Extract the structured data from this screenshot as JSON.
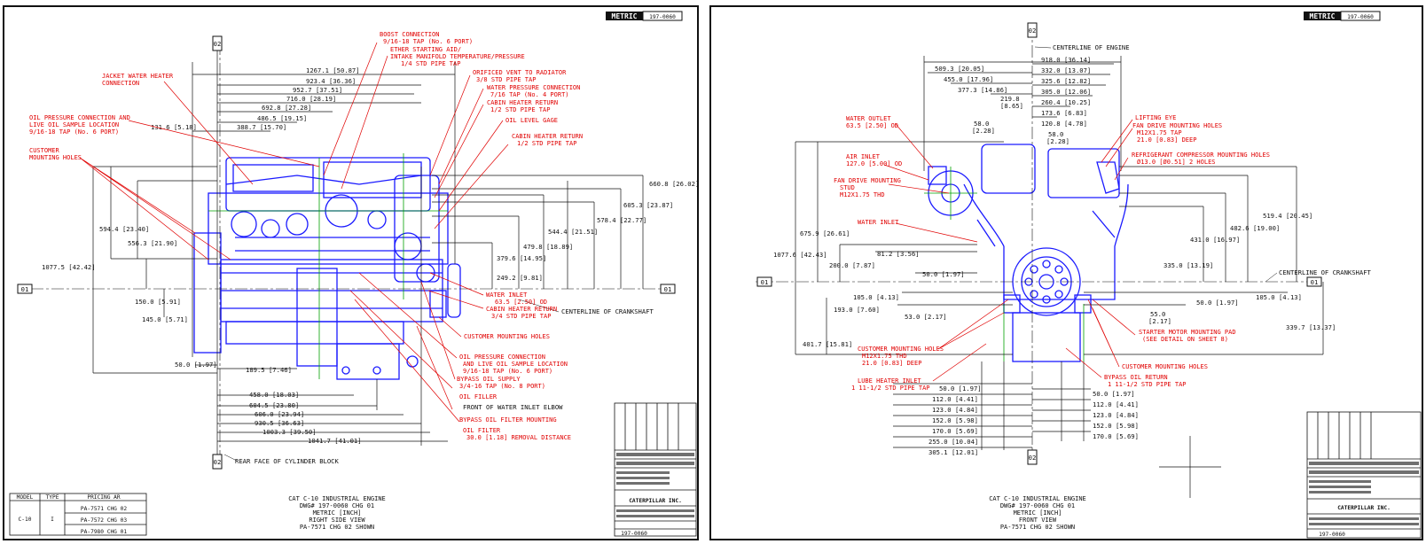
{
  "colors": {
    "engine": "#1a1aff",
    "callout": "#e00000",
    "dimension": "#111111",
    "centerline": "#00a000"
  },
  "sheet_left": {
    "metric_badge": "METRIC",
    "drawing_no": "197-0060",
    "callouts": {
      "boost": "BOOST CONNECTION",
      "boost_tap": "9/16-18 TAP (No. 6 PORT)",
      "ether": "ETHER STARTING AID/",
      "ether2": "INTAKE MANIFOLD TEMPERATURE/PRESSURE",
      "ether3": "1/4 STD PIPE TAP",
      "jacket": "JACKET WATER HEATER",
      "jacket2": "CONNECTION",
      "oil_pressure": "OIL PRESSURE CONNECTION AND",
      "oil_pressure2": "LIVE OIL SAMPLE LOCATION",
      "oil_pressure3": "9/16-18 TAP (No. 6 PORT)",
      "customer_mount": "CUSTOMER",
      "customer_mount2": "MOUNTING HOLES",
      "orificed": "ORIFICED VENT TO RADIATOR",
      "orificed2": "3/8 STD PIPE TAP",
      "water_pressure": "WATER PRESSURE CONNECTION",
      "water_pressure2": "7/16 TAP (No. 4 PORT)",
      "cabin_return": "CABIN HEATER RETURN",
      "cabin_return2": "1/2 STD PIPE TAP",
      "oil_level": "OIL LEVEL GAGE",
      "cabin_return_b": "CABIN HEATER RETURN",
      "cabin_return_b2": "1/2 STD PIPE TAP",
      "water_inlet": "WATER INLET",
      "water_inlet2": "63.5 [2.50] OD",
      "cabin_heater": "CABIN HEATER RETURN",
      "cabin_heater2": "3/4 STD PIPE TAP",
      "cust_holes": "CUSTOMER MOUNTING HOLES",
      "oil_pressure_b": "OIL PRESSURE CONNECTION",
      "oil_pressure_b2": "AND LIVE OIL SAMPLE LOCATION",
      "oil_pressure_b3": "9/16-18 TAP (No. 6 PORT)",
      "bypass_supply": "BYPASS OIL SUPPLY",
      "bypass_supply2": "3/4-16 TAP (No. 8 PORT)",
      "oil_filler": "OIL FILLER",
      "front_water": "FRONT OF WATER INLET ELBOW",
      "bypass_filter": "BYPASS OIL FILTER MOUNTING",
      "oil_filter": "OIL FILTER",
      "oil_filter2": "30.0 [1.18] REMOVAL DISTANCE"
    },
    "dims": {
      "d1": "1267.1 [50.87]",
      "d2": "923.4 [36.36]",
      "d3": "952.7 [37.51]",
      "d4": "716.0 [28.19]",
      "d5": "692.8 [27.28]",
      "d6": "486.5 [19.15]",
      "d7": "388.7 [15.70]",
      "d8": "131.6 [5.18]",
      "v1": "594.4 [23.40]",
      "v2": "556.3 [21.90]",
      "v3": "1077.5 [42.42]",
      "v4": "150.0 [5.91]",
      "v5": "145.0 [5.71]",
      "v6": "660.8 [26.02]",
      "v7": "605.3 [23.87]",
      "v8": "578.4 [22.77]",
      "v9": "544.4 [21.51]",
      "v10": "479.8 [18.89]",
      "v11": "379.6 [14.95]",
      "v12": "249.2 [9.81]",
      "h1": "50.0 [1.97]",
      "h2": "189.5 [7.46]",
      "b1": "458.0 [18.03]",
      "b2": "604.5 [23.80]",
      "b3": "606.0 [23.94]",
      "b4": "930.5 [36.63]",
      "b5": "1003.3 [39.50]",
      "b6": "1041.7 [41.01]"
    },
    "centerline_crankshaft": "CENTERLINE OF CRANKSHAFT",
    "rear_face": "REAR FACE OF CYLINDER BLOCK",
    "datum_01": "01",
    "datum_02": "02",
    "title": [
      "CAT C-10 INDUSTRIAL ENGINE",
      "DWG# 197-0060 CHG 01",
      "METRIC [INCH]",
      "RIGHT SIDE VIEW",
      "PA-7571 CHG 02 SHOWN"
    ],
    "pricing_table": {
      "headers": [
        "MODEL",
        "TYPE",
        "PRICING AR"
      ],
      "model": "C-10",
      "type": "I",
      "rows": [
        "PA-7571 CHG 02",
        "PA-7572 CHG 03",
        "PA-7980 CHG 01"
      ]
    },
    "title_block": {
      "company": "CATERPILLAR INC.",
      "sheet": "197-0060"
    }
  },
  "sheet_right": {
    "metric_badge": "METRIC",
    "drawing_no": "197-0060",
    "centerline_engine": "CENTERLINE OF ENGINE",
    "centerline_crankshaft": "CENTERLINE OF CRANKSHAFT",
    "callouts": {
      "water_outlet": "WATER OUTLET",
      "water_outlet2": "63.5 [2.50] OD",
      "air_inlet": "AIR INLET",
      "air_inlet2": "127.0 [5.00] OD",
      "fan_stud": "FAN DRIVE MOUNTING",
      "fan_stud2": "STUD",
      "fan_stud3": "M12X1.75 THD",
      "water_inlet": "WATER INLET",
      "lifting": "LIFTING EYE",
      "fan_holes": "FAN DRIVE MOUNTING HOLES",
      "fan_holes2": "M12X1.75 TAP",
      "fan_holes3": "21.0 [0.83] DEEP",
      "refrig": "REFRIGERANT COMPRESSOR MOUNTING HOLES",
      "refrig2": "Ø13.0 [Ø0.51] 2 HOLES",
      "cust_holes": "CUSTOMER MOUNTING HOLES",
      "cust_holes2": "M12X1.75 THD",
      "cust_holes3": "21.0 [0.83] DEEP",
      "lube": "LUBE HEATER INLET",
      "lube2": "1 11-1/2 STD PIPE TAP",
      "starter": "STARTER MOTOR MOUNTING PAD",
      "starter2": "(SEE DETAIL ON SHEET 8)",
      "cust_holes_r": "CUSTOMER MOUNTING HOLES",
      "bypass_return": "BYPASS OIL RETURN",
      "bypass_return2": "1 11-1/2 STD PIPE TAP"
    },
    "dims": {
      "t1": "509.3 [20.05]",
      "t2": "918.0 [36.14]",
      "t3": "455.0 [17.96]",
      "t4": "332.0 [13.07]",
      "t5": "377.3 [14.86]",
      "t6": "325.6 [12.82]",
      "t7": "305.0 [12.06]",
      "t8": "219.8",
      "t8b": "[8.65]",
      "t9": "260.4 [10.25]",
      "t10": "173.6 [6.83]",
      "t11": "120.8 [4.78]",
      "t12": "58.0",
      "t12b": "[2.28]",
      "t13": "58.0",
      "t13b": "[2.28]",
      "l1": "675.9 [26.61]",
      "l2": "1077.6 [42.43]",
      "l3": "81.2 [3.56]",
      "l4": "200.0 [7.87]",
      "l5": "50.0 [1.97]",
      "l6": "105.0 [4.13]",
      "l7": "193.0 [7.60]",
      "l8": "53.0 [2.17]",
      "l9": "401.7 [15.81]",
      "r1": "519.4 [20.45]",
      "r2": "482.6 [19.00]",
      "r3": "431.0 [16.97]",
      "r4": "335.0 [13.19]",
      "r5": "50.0 [1.97]",
      "r6": "105.0 [4.13]",
      "r7": "55.0",
      "r7b": "[2.17]",
      "r8": "339.7 [13.37]",
      "bl1": "50.0 [1.97]",
      "bl2": "112.0 [4.41]",
      "bl3": "123.0 [4.84]",
      "bl4": "152.0 [5.98]",
      "bl5": "170.0 [5.69]",
      "bl6": "255.0 [10.04]",
      "bl7": "305.1 [12.01]",
      "br1": "50.0 [1.97]",
      "br2": "112.0 [4.41]",
      "br3": "123.0 [4.84]",
      "br4": "152.0 [5.98]",
      "br5": "170.0 [5.69]"
    },
    "datum_01": "01",
    "datum_02": "02",
    "title": [
      "CAT C-10 INDUSTRIAL ENGINE",
      "DWG# 197-0060 CHG 01",
      "METRIC [INCH]",
      "FRONT VIEW",
      "PA-7571 CHG 02 SHOWN"
    ],
    "title_block": {
      "company": "CATERPILLAR INC.",
      "sheet": "197-0060"
    }
  }
}
